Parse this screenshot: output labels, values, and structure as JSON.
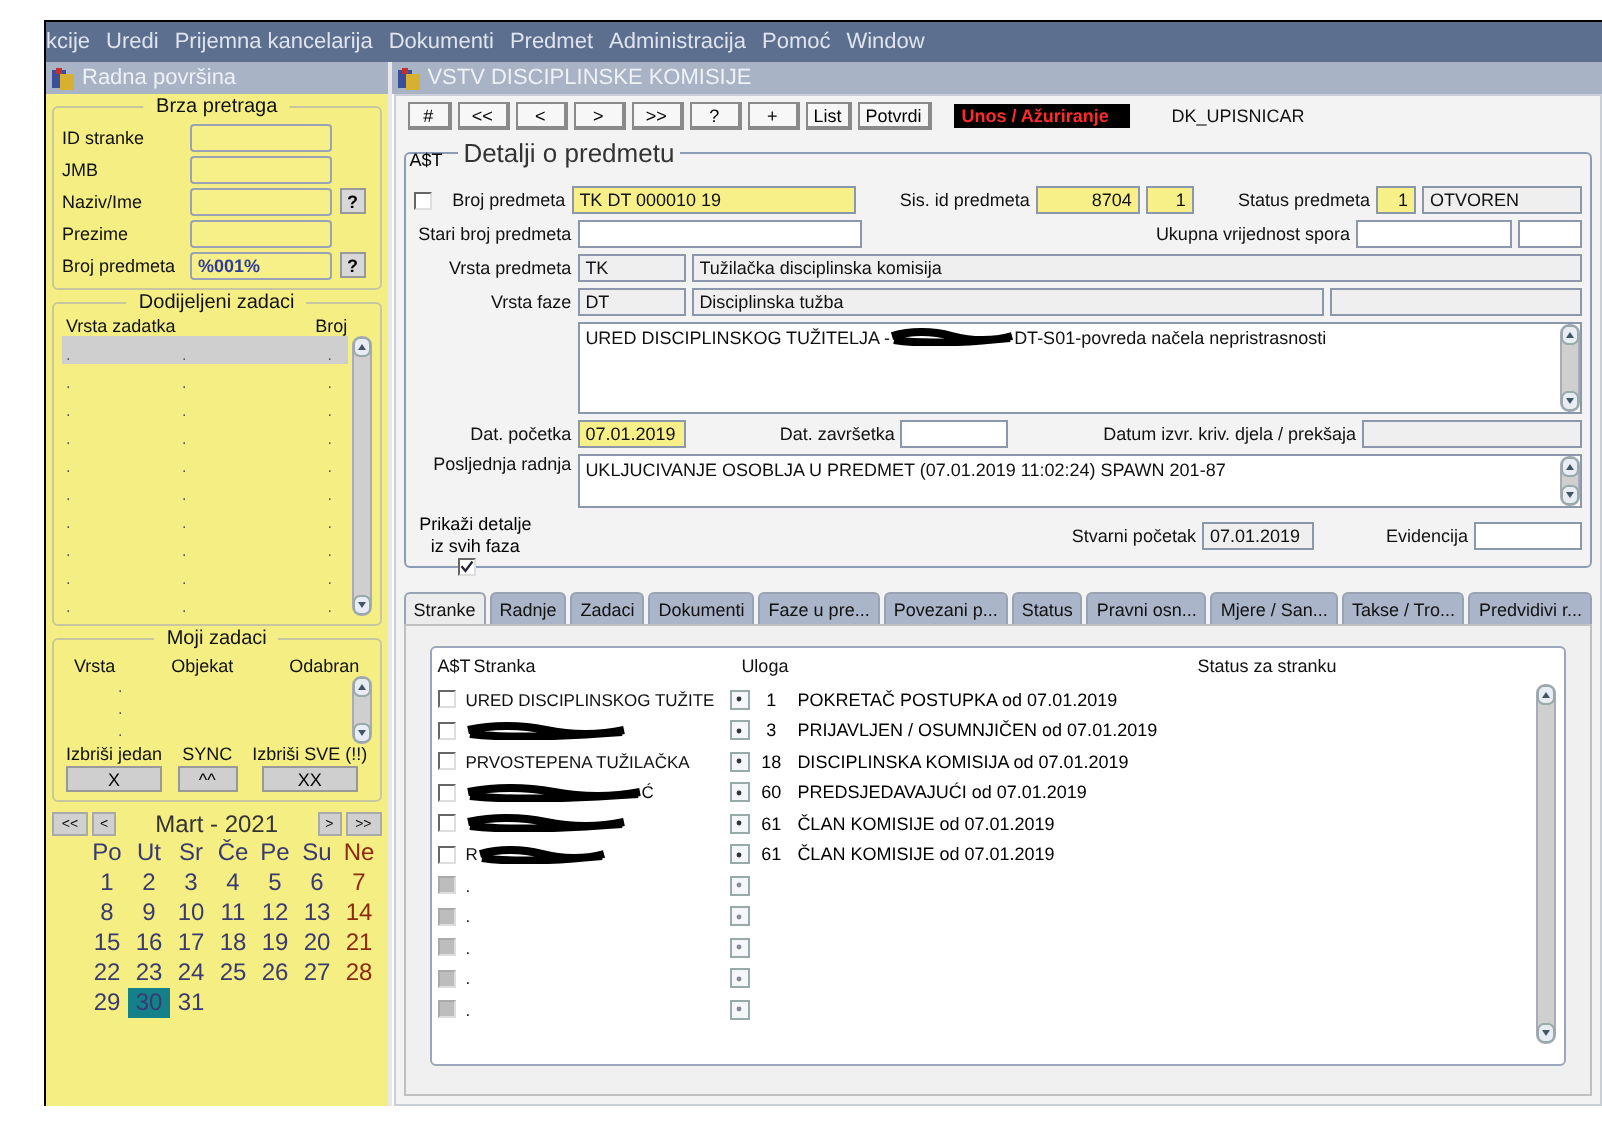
{
  "menu": [
    "kcije",
    "Uredi",
    "Prijemna kancelarija",
    "Dokumenti",
    "Predmet",
    "Administracija",
    "Pomoć",
    "Window"
  ],
  "workspace": {
    "title": "Radna površina",
    "quick_search": {
      "title": "Brza pretraga",
      "fields": [
        {
          "label": "ID stranke"
        },
        {
          "label": "JMB"
        },
        {
          "label": "Naziv/Ime",
          "help": "?"
        },
        {
          "label": "Prezime"
        },
        {
          "label": "Broj predmeta",
          "value": "%001%",
          "help": "?"
        }
      ]
    },
    "assigned_tasks": {
      "title": "Dodijeljeni zadaci",
      "columns": [
        "Vrsta zadatka",
        "",
        "Broj"
      ],
      "rows": [
        {
          "cells": [
            ".",
            ".",
            "."
          ],
          "selected": true
        },
        {
          "cells": [
            ".",
            ".",
            "."
          ],
          "selected": false
        },
        {
          "cells": [
            ".",
            ".",
            "."
          ],
          "selected": false
        },
        {
          "cells": [
            ".",
            ".",
            "."
          ],
          "selected": false
        },
        {
          "cells": [
            ".",
            ".",
            "."
          ],
          "selected": false
        },
        {
          "cells": [
            ".",
            ".",
            "."
          ],
          "selected": false
        },
        {
          "cells": [
            ".",
            ".",
            "."
          ],
          "selected": false
        },
        {
          "cells": [
            ".",
            ".",
            "."
          ],
          "selected": false
        },
        {
          "cells": [
            ".",
            ".",
            "."
          ],
          "selected": false
        },
        {
          "cells": [
            ".",
            ".",
            "."
          ],
          "selected": false
        }
      ]
    },
    "my_tasks": {
      "title": "Moji zadaci",
      "columns": [
        "Vrsta",
        "Objekat",
        "Odabran"
      ],
      "rows": [
        ".",
        ".",
        "."
      ],
      "actions": [
        {
          "label": "Izbriši jedan",
          "button": "X"
        },
        {
          "label": "SYNC",
          "button": "^^"
        },
        {
          "label": "Izbriši SVE (!!)",
          "button": "XX"
        }
      ]
    },
    "calendar": {
      "month": "Mart - 2021",
      "prev": [
        "<<",
        "<"
      ],
      "next": [
        ">",
        ">>"
      ],
      "weekdays": [
        "Po",
        "Ut",
        "Sr",
        "Če",
        "Pe",
        "Su",
        "Ne"
      ],
      "weeks": [
        [
          {
            "day": "1",
            "selected": false
          },
          {
            "day": "2",
            "selected": false
          },
          {
            "day": "3",
            "selected": false
          },
          {
            "day": "4",
            "selected": false
          },
          {
            "day": "5",
            "selected": false
          },
          {
            "day": "6",
            "selected": false
          },
          {
            "day": "7",
            "selected": false
          }
        ],
        [
          {
            "day": "8",
            "selected": false
          },
          {
            "day": "9",
            "selected": false
          },
          {
            "day": "10",
            "selected": false
          },
          {
            "day": "11",
            "selected": false
          },
          {
            "day": "12",
            "selected": false
          },
          {
            "day": "13",
            "selected": false
          },
          {
            "day": "14",
            "selected": false
          }
        ],
        [
          {
            "day": "15",
            "selected": false
          },
          {
            "day": "16",
            "selected": false
          },
          {
            "day": "17",
            "selected": false
          },
          {
            "day": "18",
            "selected": false
          },
          {
            "day": "19",
            "selected": false
          },
          {
            "day": "20",
            "selected": false
          },
          {
            "day": "21",
            "selected": false
          }
        ],
        [
          {
            "day": "22",
            "selected": false
          },
          {
            "day": "23",
            "selected": false
          },
          {
            "day": "24",
            "selected": false
          },
          {
            "day": "25",
            "selected": false
          },
          {
            "day": "26",
            "selected": false
          },
          {
            "day": "27",
            "selected": false
          },
          {
            "day": "28",
            "selected": false
          }
        ],
        [
          {
            "day": "29",
            "selected": false
          },
          {
            "day": "30",
            "selected": true
          },
          {
            "day": "31",
            "selected": false
          }
        ]
      ]
    }
  },
  "main": {
    "title": "VSTV DISCIPLINSKE KOMISIJE",
    "toolbar": [
      "#",
      "<<",
      "<",
      ">",
      ">>",
      "?",
      "+",
      "List",
      "Potvrdi"
    ],
    "mode": "Unos / Ažuriranje",
    "form_name": "DK_UPISNICAR",
    "details": {
      "title": "Detalji o predmetu",
      "flag": "A$T",
      "flag_checked": false,
      "case_number": {
        "label": "Broj predmeta",
        "value": "TK DT 000010 19"
      },
      "system_id": {
        "label": "Sis. id predmeta",
        "value": "8704",
        "version": "1"
      },
      "status": {
        "label": "Status predmeta",
        "code": "1",
        "value": "OTVOREN"
      },
      "old_number": {
        "label": "Stari broj predmeta"
      },
      "dispute_value": {
        "label": "Ukupna vrijednost spora"
      },
      "case_type": {
        "label": "Vrsta predmeta",
        "code": "TK",
        "value": "Tužilačka disciplinska komisija"
      },
      "phase_type": {
        "label": "Vrsta faze",
        "code": "DT",
        "value": "Disciplinska tužba"
      },
      "description": {
        "before": "URED DISCIPLINSKOG TUŽITELJA - ",
        "after": "DT-S01-povreda načela nepristrasnosti"
      },
      "start_date": {
        "label": "Dat. početka",
        "value": "07.01.2019"
      },
      "end_date": {
        "label": "Dat. završetka"
      },
      "offense_date": {
        "label": "Datum izvr. kriv. djela / prekšaja"
      },
      "last_action": {
        "label": "Posljednja radnja",
        "value": "UKLJUCIVANJE OSOBLJA U PREDMET (07.01.2019 11:02:24) SPAWN 201-87"
      },
      "show_all_phases": {
        "label": "Prikaži detalje iz svih faza",
        "checked": true
      },
      "actual_start": {
        "label": "Stvarni početak",
        "value": "07.01.2019"
      },
      "records": {
        "label": "Evidencija"
      }
    },
    "tabs": [
      {
        "label": "Stranke",
        "selected": true
      },
      {
        "label": "Radnje",
        "selected": false
      },
      {
        "label": "Zadaci",
        "selected": false
      },
      {
        "label": "Dokumenti",
        "selected": false
      },
      {
        "label": "Faze u pre...",
        "selected": false
      },
      {
        "label": "Povezani p...",
        "selected": false
      },
      {
        "label": "Status",
        "selected": false
      },
      {
        "label": "Pravni osn...",
        "selected": false
      },
      {
        "label": "Mjere / San...",
        "selected": false
      },
      {
        "label": "Takse / Tro...",
        "selected": false
      },
      {
        "label": "Predvidivi r...",
        "selected": false
      }
    ],
    "parties": {
      "flag": "A$T",
      "columns": [
        "Stranka",
        "Uloga",
        "Status za stranku"
      ],
      "rows": [
        {
          "kind": "filled",
          "checked": false,
          "disabled": false,
          "name": "URED DISCIPLINSKOG TUŽITE",
          "code": "1",
          "role": "POKRETAČ POSTUPKA od 07.01.2019"
        },
        {
          "kind": "filled",
          "checked": false,
          "disabled": false,
          "redacted_before": true,
          "code": "3",
          "role": "PRIJAVLJEN / OSUMNJIČEN od 07.01.2019"
        },
        {
          "kind": "filled",
          "checked": false,
          "disabled": false,
          "name": "PRVOSTEPENA TUŽILAČKA",
          "code": "18",
          "role": "DISCIPLINSKA KOMISIJA od 07.01.2019"
        },
        {
          "kind": "filled",
          "checked": false,
          "disabled": false,
          "name": "Ć",
          "redacted_before": true,
          "code": "60",
          "role": "PREDSJEDAVAJUĆI od 07.01.2019"
        },
        {
          "kind": "filled",
          "checked": false,
          "disabled": false,
          "redacted_before": true,
          "code": "61",
          "role": "ČLAN KOMISIJE od 07.01.2019"
        },
        {
          "kind": "filled",
          "checked": false,
          "disabled": false,
          "name": "R",
          "redacted_after": true,
          "code": "61",
          "role": "ČLAN KOMISIJE od 07.01.2019"
        },
        {
          "kind": "empty",
          "disabled": true,
          "name": "."
        },
        {
          "kind": "empty",
          "disabled": true,
          "name": "."
        },
        {
          "kind": "empty",
          "disabled": true,
          "name": "."
        },
        {
          "kind": "empty",
          "disabled": true,
          "name": "."
        },
        {
          "kind": "empty",
          "disabled": true,
          "name": "."
        }
      ]
    }
  }
}
